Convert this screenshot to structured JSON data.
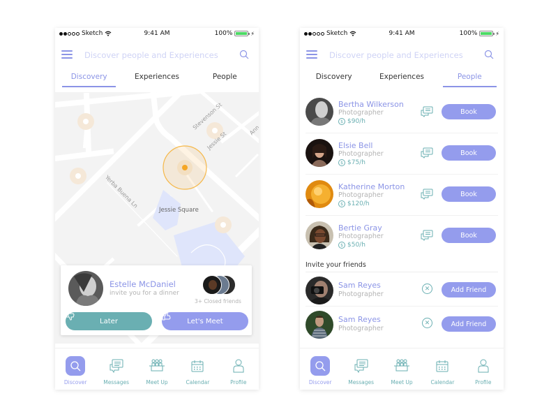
{
  "status_bar": {
    "carrier": "Sketch",
    "time": "9:41 AM",
    "battery": "100%",
    "signal_bars_filled": 2,
    "signal_bars_total": 5
  },
  "header": {
    "search_placeholder": "Discover people and Experiences",
    "menu_icon": "hamburger-icon",
    "search_icon": "search-icon"
  },
  "tabs": [
    {
      "label": "Discovery"
    },
    {
      "label": "Experiences"
    },
    {
      "label": "People"
    }
  ],
  "left_screen": {
    "active_tab": "Discovery",
    "map": {
      "labels": {
        "street1": "Stevenson St",
        "street2": "Jessie St",
        "street3": "Yerba Buena Ln",
        "street4": "Ann",
        "park": "Jessie Square"
      }
    },
    "invite_card": {
      "name": "Estelle McDaniel",
      "message": "invite you for a dinner",
      "friends_count": "3+ Closed friends",
      "later_label": "Later",
      "meet_label": "Let's Meet"
    }
  },
  "right_screen": {
    "active_tab": "People",
    "people": [
      {
        "name": "Bertha Wilkerson",
        "role": "Photographer",
        "rate": "$90/h",
        "action": "Book"
      },
      {
        "name": "Elsie Bell",
        "role": "Photographer",
        "rate": "$75/h",
        "action": "Book"
      },
      {
        "name": "Katherine Morton",
        "role": "Photographer",
        "rate": "$120/h",
        "action": "Book"
      },
      {
        "name": "Bertie Gray",
        "role": "Photographer",
        "rate": "$50/h",
        "action": "Book"
      }
    ],
    "invite_section_title": "Invite your friends",
    "friends": [
      {
        "name": "Sam Reyes",
        "role": "Photographer",
        "action": "Add Friend"
      },
      {
        "name": "Sam Reyes",
        "role": "Photographer",
        "action": "Add Friend"
      }
    ]
  },
  "bottom_nav": [
    {
      "label": "Discover",
      "icon": "search-icon",
      "active": true
    },
    {
      "label": "Messages",
      "icon": "messages-icon"
    },
    {
      "label": "Meet Up",
      "icon": "meetup-icon"
    },
    {
      "label": "Calendar",
      "icon": "calendar-icon"
    },
    {
      "label": "Profile",
      "icon": "profile-icon"
    }
  ],
  "colors": {
    "accent": "#949ced",
    "teal": "#6aafb2",
    "marker": "#f5a623"
  }
}
